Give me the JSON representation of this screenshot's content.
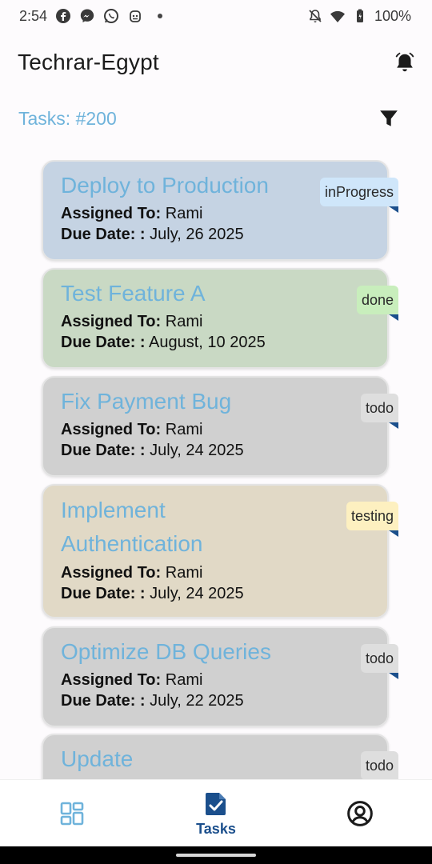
{
  "status_bar": {
    "time": "2:54",
    "battery": "100%",
    "icons": [
      "facebook-icon",
      "messenger-icon",
      "whatsapp-icon",
      "bot-icon",
      "notifications-off-icon",
      "wifi-icon",
      "battery-icon"
    ]
  },
  "app_bar": {
    "title": "Techrar-Egypt",
    "notification_icon": "bell-icon"
  },
  "tasks_header": {
    "count_label": "Tasks: #200",
    "filter_icon": "filter-icon"
  },
  "labels": {
    "assigned_to": "Assigned To:",
    "due_date": "Due Date: :"
  },
  "tasks": [
    {
      "title": "Deploy to Production",
      "assignee": "Rami",
      "due_date": "July, 26 2025",
      "status": "inProgress",
      "card_color": "#c5d3e3",
      "badge_color": "#cfe6fa"
    },
    {
      "title": "Test Feature A",
      "assignee": "Rami",
      "due_date": "August, 10 2025",
      "status": "done",
      "card_color": "#c9d9c4",
      "badge_color": "#c8eebc"
    },
    {
      "title": "Fix Payment Bug",
      "assignee": "Rami",
      "due_date": "July, 24 2025",
      "status": "todo",
      "card_color": "#d0d0d0",
      "badge_color": "#dedede"
    },
    {
      "title": "Implement Authentication",
      "assignee": "Rami",
      "due_date": "July, 24 2025",
      "status": "testing",
      "card_color": "#e1d9c6",
      "badge_color": "#fdf0c0"
    },
    {
      "title": "Optimize DB Queries",
      "assignee": "Rami",
      "due_date": "July, 22 2025",
      "status": "todo",
      "card_color": "#d0d0d0",
      "badge_color": "#dedede"
    },
    {
      "title": "Update",
      "status": "todo",
      "card_color": "#d0d0d0",
      "badge_color": "#dedede"
    }
  ],
  "bottom_nav": {
    "items": [
      {
        "icon": "dashboard-icon",
        "label": ""
      },
      {
        "icon": "tasks-icon",
        "label": "Tasks",
        "active": true
      },
      {
        "icon": "profile-icon",
        "label": ""
      }
    ]
  },
  "colors": {
    "accent": "#6fb3db",
    "nav_active": "#1b4f8c"
  }
}
